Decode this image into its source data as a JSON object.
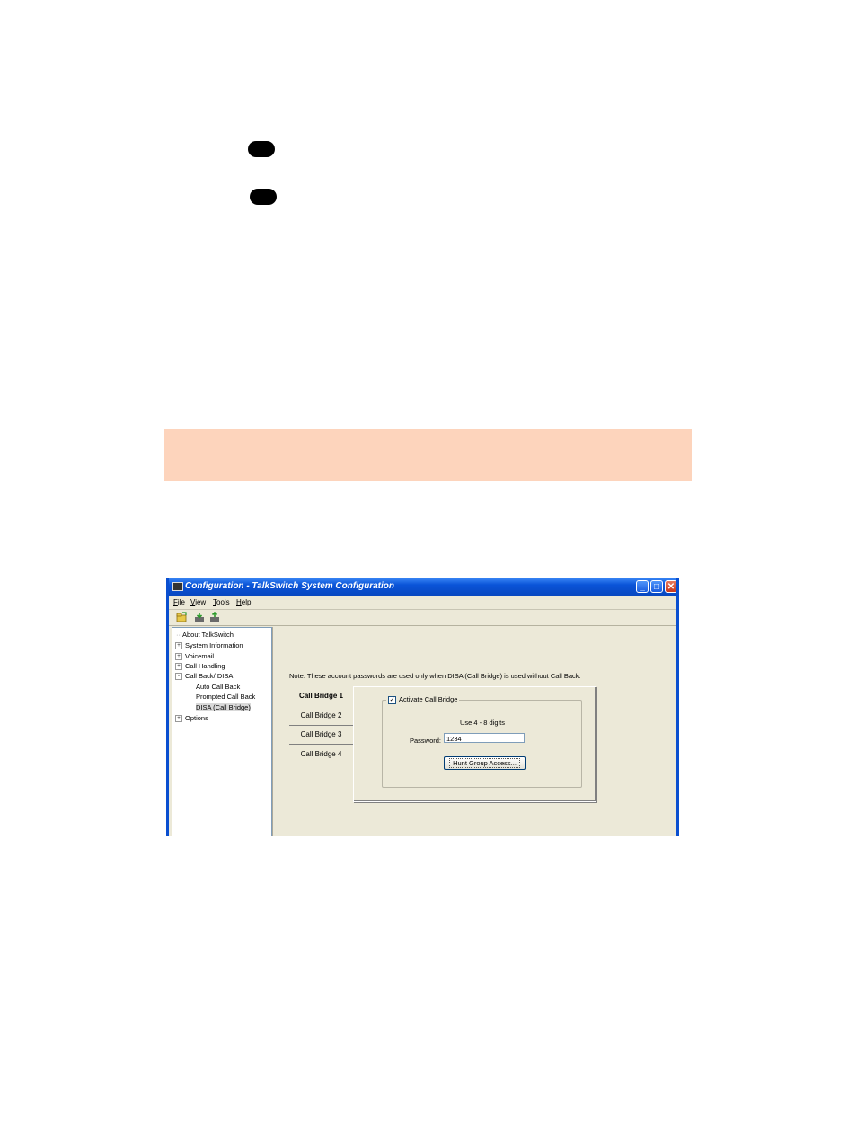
{
  "window": {
    "title": "Configuration - TalkSwitch System Configuration",
    "min_glyph": "_",
    "max_glyph": "□",
    "close_glyph": "✕"
  },
  "menu": {
    "file": "File",
    "view": "View",
    "tools": "Tools",
    "help": "Help"
  },
  "tree": {
    "items": [
      {
        "label": "About TalkSwitch",
        "expander": ""
      },
      {
        "label": "System Information",
        "expander": "+"
      },
      {
        "label": "Voicemail",
        "expander": "+"
      },
      {
        "label": "Call Handling",
        "expander": "+"
      },
      {
        "label": "Call Back/ DISA",
        "expander": "-"
      },
      {
        "label": "Auto Call Back",
        "expander": ""
      },
      {
        "label": "Prompted Call Back",
        "expander": ""
      },
      {
        "label": "DISA (Call Bridge)",
        "expander": ""
      },
      {
        "label": "Options",
        "expander": "+"
      }
    ]
  },
  "main": {
    "note": "Note: These account passwords are used only when DISA (Call Bridge) is used without Call Back.",
    "tabs": [
      "Call Bridge 1",
      "Call Bridge 2",
      "Call Bridge 3",
      "Call Bridge 4"
    ],
    "activate_label": "Activate Call Bridge",
    "activate_check": "✓",
    "digits_hint": "Use 4 - 8 digits",
    "password_label": "Password:",
    "password_value": "1234",
    "hunt_button": "Hunt Group Access..."
  },
  "colors": {
    "title_bar": "#0a54d8",
    "note_band": "#fdd4bc",
    "window_bg": "#ece9d8"
  }
}
